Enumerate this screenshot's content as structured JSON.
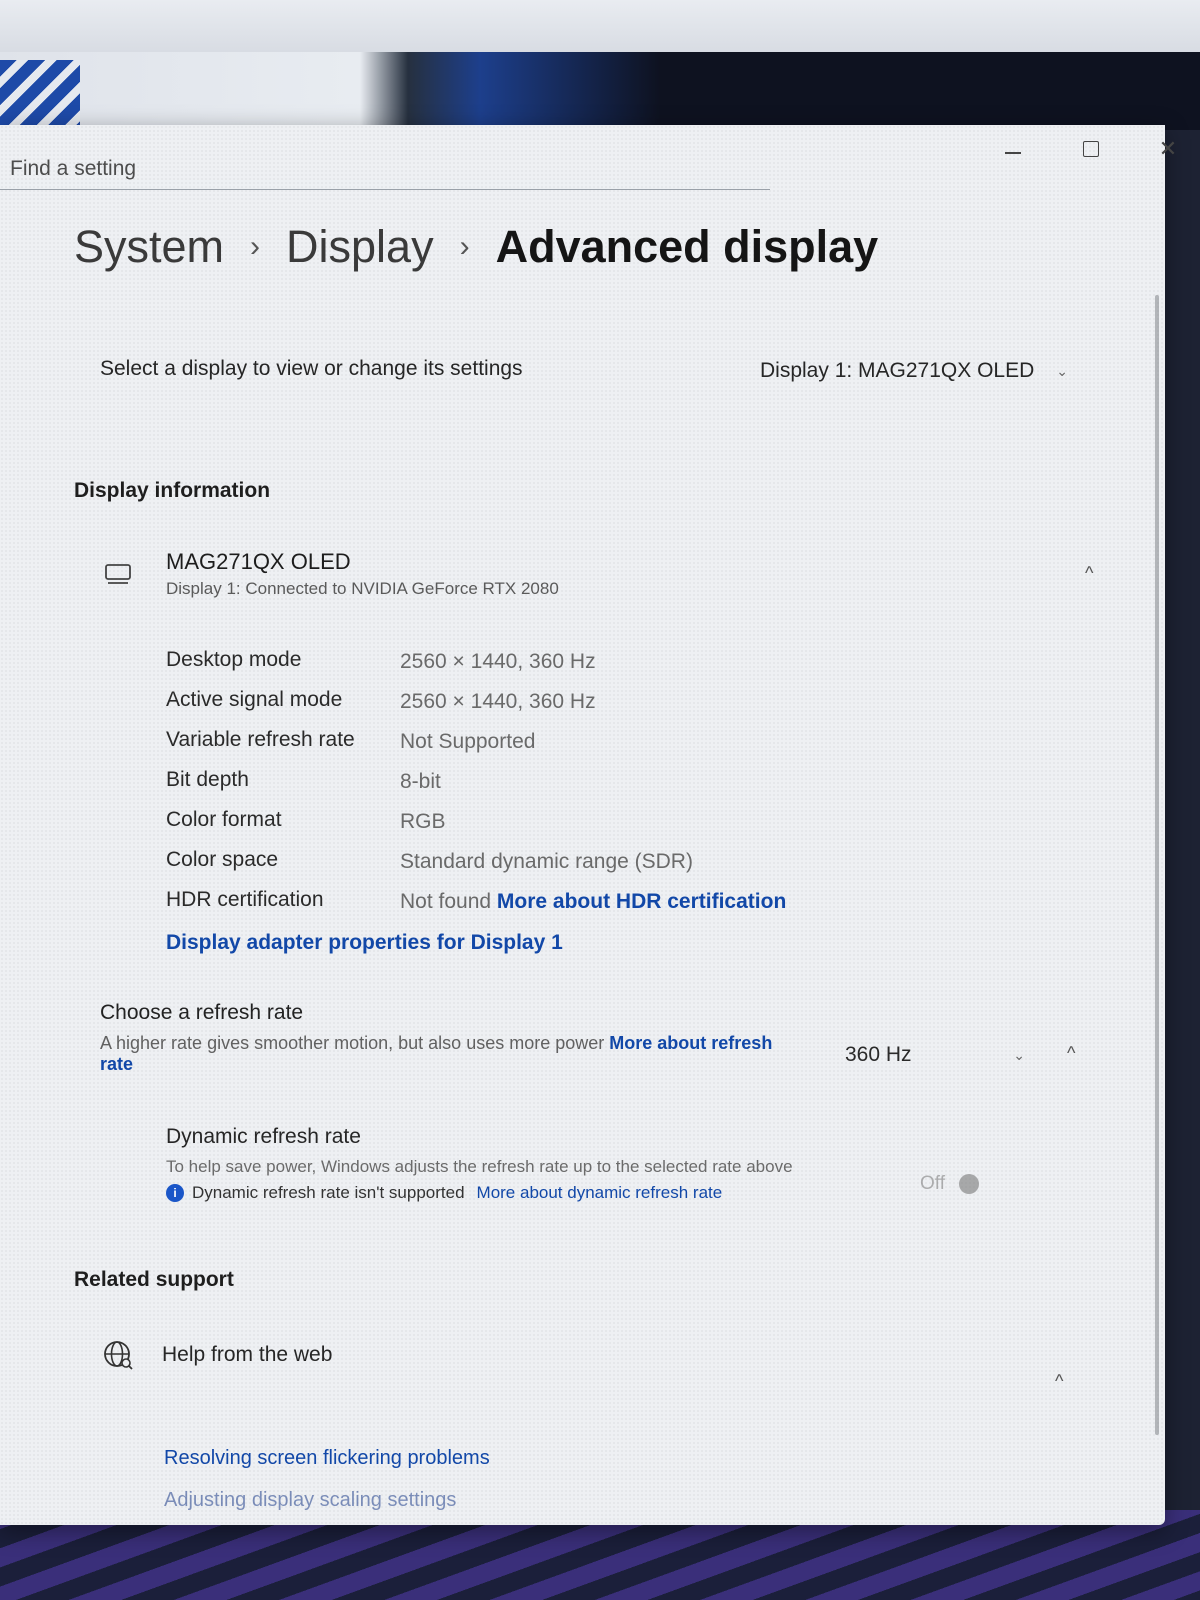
{
  "window": {
    "minimize_glyph": "—",
    "maximize_glyph": "☐",
    "close_glyph": "✕"
  },
  "search": {
    "placeholder": "Find a setting"
  },
  "breadcrumb": {
    "items": [
      "System",
      "Display",
      "Advanced display"
    ],
    "separator": "›"
  },
  "display_selector": {
    "label": "Select a display to view or change its settings",
    "value": "Display 1: MAG271QX OLED",
    "chevron": "⌄"
  },
  "display_information": {
    "title": "Display information",
    "monitor_name": "MAG271QX OLED",
    "monitor_subtitle": "Display 1: Connected to NVIDIA GeForce RTX 2080",
    "collapse_glyph": "^",
    "rows": [
      {
        "key": "Desktop mode",
        "value": "2560 × 1440, 360 Hz"
      },
      {
        "key": "Active signal mode",
        "value": "2560 × 1440, 360 Hz"
      },
      {
        "key": "Variable refresh rate",
        "value": "Not Supported"
      },
      {
        "key": "Bit depth",
        "value": "8-bit"
      },
      {
        "key": "Color format",
        "value": "RGB"
      },
      {
        "key": "Color space",
        "value": "Standard dynamic range (SDR)"
      },
      {
        "key": "HDR certification",
        "value": "Not found",
        "link": "More about HDR certification"
      }
    ],
    "adapter_link": "Display adapter properties for Display 1"
  },
  "refresh_rate": {
    "title": "Choose a refresh rate",
    "description": "A higher rate gives smoother motion, but also uses more power",
    "link": "More about refresh rate",
    "value": "360 Hz",
    "chevron": "⌄",
    "collapse_glyph": "^"
  },
  "dynamic_refresh": {
    "title": "Dynamic refresh rate",
    "description": "To help save power, Windows adjusts the refresh rate up to the selected rate above",
    "info_text": "Dynamic refresh rate isn't supported",
    "info_glyph": "i",
    "link": "More about dynamic refresh rate",
    "toggle_state": "Off"
  },
  "related_support": {
    "title": "Related support",
    "help_label": "Help from the web",
    "collapse_glyph": "^",
    "links": [
      "Resolving screen flickering problems",
      "Adjusting display scaling settings"
    ]
  },
  "colors": {
    "link": "#1248a8",
    "accent": "#1a56c8"
  }
}
